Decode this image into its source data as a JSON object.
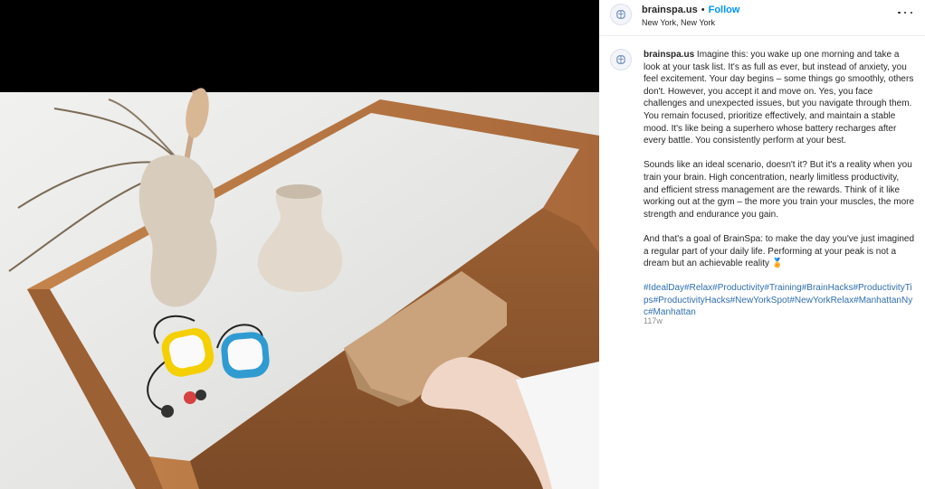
{
  "post": {
    "username": "brainspa.us",
    "separator": "•",
    "follow_label": "Follow",
    "location": "New York, New York",
    "more_icon": "more-horizontal-icon",
    "avatar_icon": "brain-logo-icon",
    "caption": {
      "username": "brainspa.us",
      "paragraph_1": "Imagine this: you wake up one morning and take a look at your task list. It's as full as ever, but instead of anxiety, you feel excitement. Your day begins – some things go smoothly, others don't. However, you accept it and move on. Yes, you face challenges and unexpected issues, but you navigate through them. You remain focused, prioritize effectively, and maintain a stable mood. It's like being a superhero whose battery recharges after every battle. You consistently perform at your best.",
      "paragraph_2": "Sounds like an ideal scenario, doesn't it? But it's a reality when you train your brain. High concentration, nearly limitless productivity, and efficient stress management are the rewards. Think of it like working out at the gym – the more you train your muscles, the more strength and endurance you gain.",
      "paragraph_3": "And that's a goal of BrainSpa: to make the day you've just imagined a regular part of your daily life. Performing at your peak is not a dream but an achievable reality 🏅",
      "hashtags": [
        "#IdealDay",
        "#Relax",
        "#Productivity",
        "#Training",
        "#BrainHacks",
        "#ProductivityTips",
        "#ProductivityHacks",
        "#NewYorkSpot",
        "#NewYorkRelax",
        "#ManhattanNyc",
        "#Manhattan"
      ]
    },
    "timestamp": "117w"
  },
  "media": {
    "description_icon": "post-image",
    "colors": {
      "wood": "#b9773f",
      "marble": "#e6e6e4",
      "wall": "#e9e9e7",
      "vase": "#dccfbf",
      "device_yellow": "#f5d000",
      "device_blue": "#2f9bd1"
    }
  }
}
